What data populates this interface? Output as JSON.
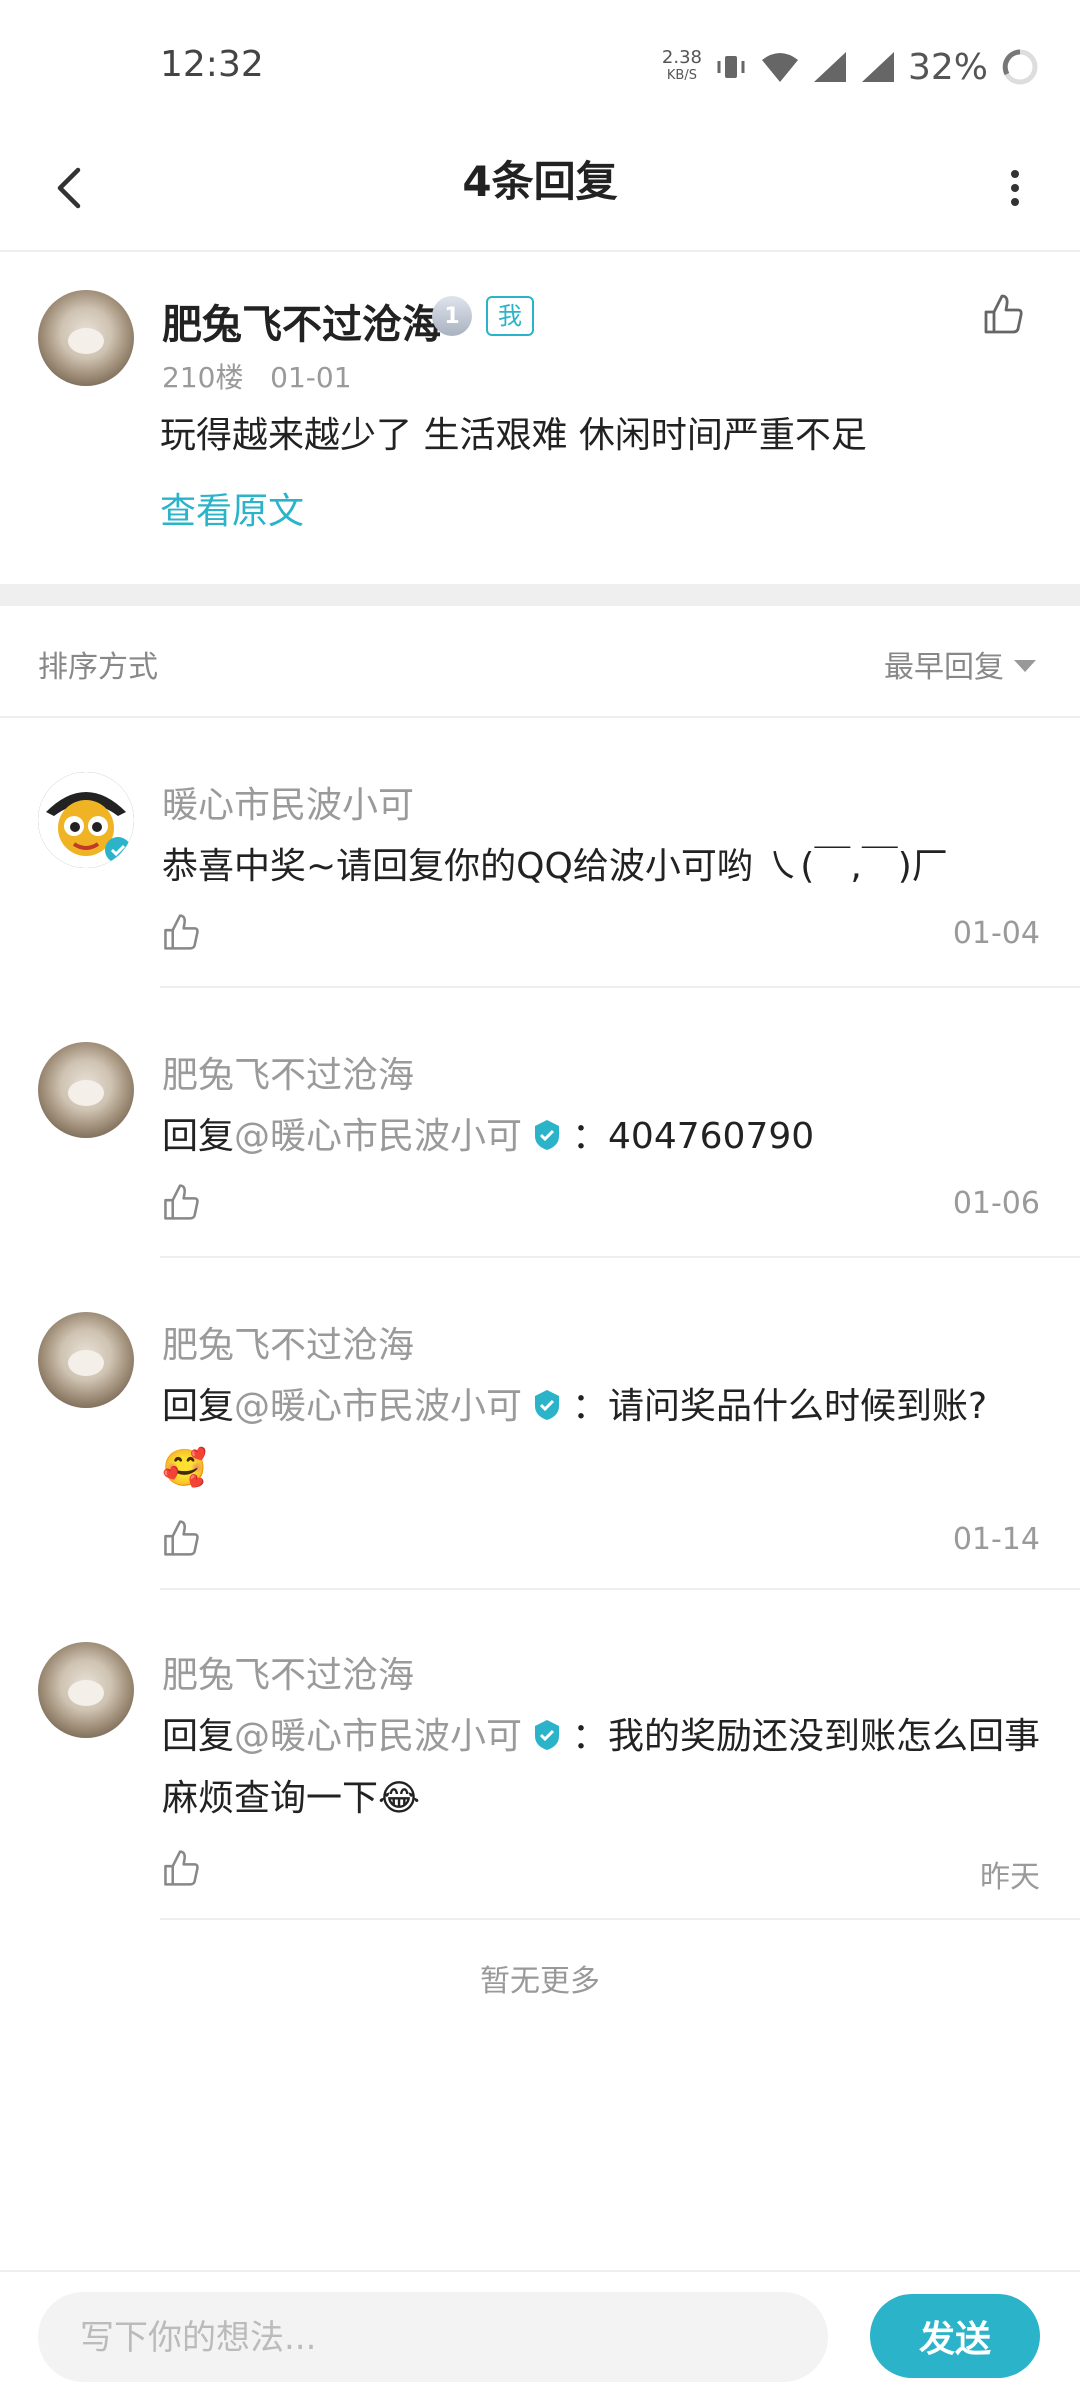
{
  "status_bar": {
    "time": "12:32",
    "net_speed_value": "2.38",
    "net_speed_unit": "KB/S",
    "battery": "32%"
  },
  "nav": {
    "title": "4条回复",
    "back_icon": "chevron-left-icon",
    "more_icon": "more-vertical-icon"
  },
  "main_post": {
    "author": "肥兔飞不过沧海",
    "level": "1",
    "me_badge": "我",
    "floor": "210楼",
    "date": "01-01",
    "content": "玩得越来越少了 生活艰难 休闲时间严重不足",
    "view_original": "查看原文"
  },
  "sort": {
    "label": "排序方式",
    "selected": "最早回复"
  },
  "replies": [
    {
      "author": "暖心市民波小可",
      "content": "恭喜中奖~请回复你的QQ给波小可哟 ㇏(￣,￣)厂",
      "time": "01-04"
    },
    {
      "author": "肥兔飞不过沧海",
      "prefix": "回复",
      "mention": "@暖心市民波小可",
      "text": "：404760790",
      "time": "01-06"
    },
    {
      "author": "肥兔飞不过沧海",
      "prefix": "回复",
      "mention": "@暖心市民波小可",
      "text": "：请问奖品什么时候到账?",
      "emoji": "🥰",
      "time": "01-14"
    },
    {
      "author": "肥兔飞不过沧海",
      "prefix": "回复",
      "mention": "@暖心市民波小可",
      "text": "：我的奖励还没到账怎么回事 麻烦查询一下",
      "emoji": "😂",
      "time": "昨天"
    }
  ],
  "footer_note": "暂无更多",
  "composer": {
    "placeholder": "写下你的想法...",
    "send_label": "发送"
  },
  "colors": {
    "accent": "#2bb3c9",
    "muted_text": "#9a9a9a",
    "divider": "#eeeeee"
  }
}
